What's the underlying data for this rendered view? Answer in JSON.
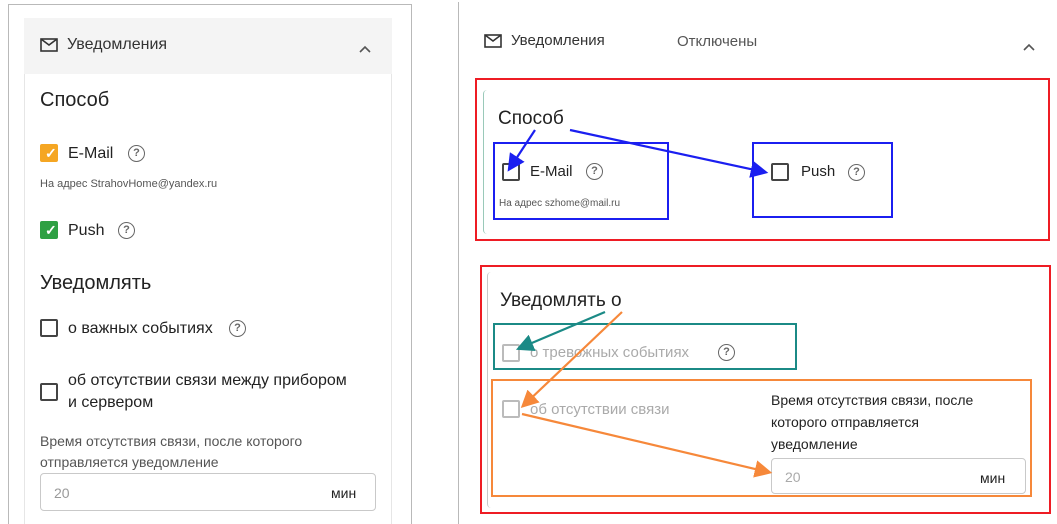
{
  "left": {
    "header": {
      "title": "Уведомления"
    },
    "method": {
      "title": "Способ",
      "email_label": "E-Mail",
      "email_hint": "На адрес StrahovHome@yandex.ru",
      "push_label": "Push"
    },
    "notify": {
      "title": "Уведомлять",
      "important_label": "о важных событиях",
      "no_connection_label_line1": "об отсутствии связи между прибором",
      "no_connection_label_line2": "и сервером",
      "delay_label_line1": "Время отсутствия связи, после которого",
      "delay_label_line2": "отправляется уведомление",
      "delay_value": "20",
      "delay_unit": "мин"
    }
  },
  "right": {
    "header": {
      "title": "Уведомления",
      "status": "Отключены"
    },
    "method": {
      "title": "Способ",
      "email_label": "E-Mail",
      "email_hint": "На адрес szhome@mail.ru",
      "push_label": "Push"
    },
    "notify": {
      "title": "Уведомлять о",
      "alarm_label": "о тревожных событиях",
      "no_connection_label": "об отсутствии связи",
      "delay_label_line1": "Время отсутствия связи, после",
      "delay_label_line2": "которого отправляется",
      "delay_label_line3": "уведомление",
      "delay_value": "20",
      "delay_unit": "мин"
    }
  },
  "colors": {
    "red_box": "#ee1c24",
    "blue_box": "#1b1ff0",
    "teal_box": "#1b8a86",
    "orange_box": "#f6883a",
    "checkbox_orange": "#f5a623",
    "checkbox_green": "#2ea043"
  },
  "icons": {
    "mail": "mail-icon",
    "collapse": "chevron-up-icon",
    "help": "help-circle-icon"
  }
}
